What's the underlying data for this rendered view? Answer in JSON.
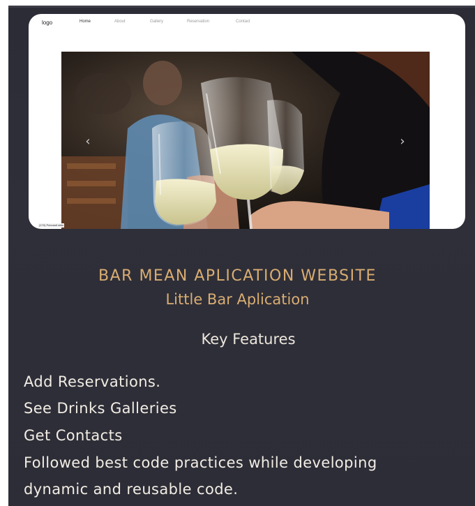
{
  "nav": {
    "logo": "logo",
    "links": [
      {
        "label": "Home",
        "active": true
      },
      {
        "label": "About",
        "active": false
      },
      {
        "label": "Gallery",
        "active": false
      },
      {
        "label": "Reservation",
        "active": false
      },
      {
        "label": "Contact",
        "active": false
      }
    ]
  },
  "carousel": {
    "prev_glyph": "‹",
    "next_glyph": "›",
    "caption": "(170) Pubvault slide"
  },
  "title": "BAR MEAN APLICATION WEBSITE",
  "subtitle": "Little Bar Aplication",
  "features_heading": "Key Features",
  "features": [
    "Add Reservations.",
    "See Drinks Galleries",
    "Get Contacts",
    "Followed best code practices while developing",
    "dynamic and reusable code."
  ],
  "colors": {
    "background": "#2e2e38",
    "accent": "#d9ad72",
    "text": "#f2ede4"
  }
}
